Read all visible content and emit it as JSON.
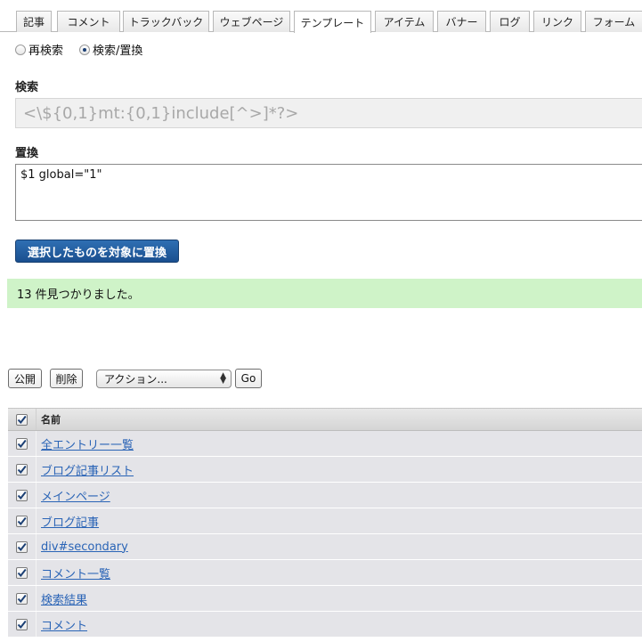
{
  "tabs": [
    "記事",
    "コメント",
    "トラックバック",
    "ウェブページ",
    "テンプレート",
    "アイテム",
    "バナー",
    "ログ",
    "リンク",
    "フォーム"
  ],
  "active_tab": "テンプレート",
  "mode": {
    "options": [
      "再検索",
      "検索/置換"
    ],
    "selected": "検索/置換"
  },
  "search": {
    "label": "検索",
    "value": "<\\${0,1}mt:{0,1}include[^>]*?>"
  },
  "replace": {
    "label": "置換",
    "value": "$1 global=\"1\""
  },
  "replace_button": "選択したものを対象に置換",
  "result_message": "13 件見つかりました。",
  "actions": {
    "publish": "公開",
    "delete": "削除",
    "action_select": "アクション...",
    "go": "Go"
  },
  "table": {
    "header": "名前",
    "rows": [
      {
        "name": "全エントリー一覧",
        "checked": true
      },
      {
        "name": "ブログ記事リスト",
        "checked": true
      },
      {
        "name": "メインページ",
        "checked": true
      },
      {
        "name": "ブログ記事",
        "checked": true
      },
      {
        "name": "div#secondary",
        "checked": true
      },
      {
        "name": "コメント一覧",
        "checked": true
      },
      {
        "name": "検索結果",
        "checked": true
      },
      {
        "name": "コメント",
        "checked": true
      }
    ]
  }
}
